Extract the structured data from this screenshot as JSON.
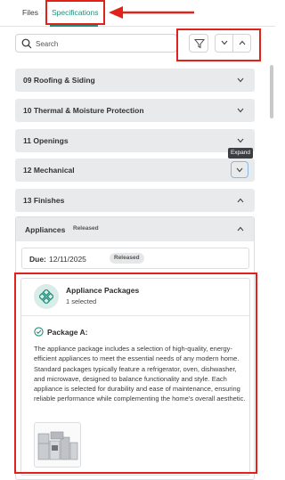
{
  "tabs": [
    {
      "label": "Files"
    },
    {
      "label": "Specifications",
      "active": true
    }
  ],
  "search": {
    "placeholder": "Search"
  },
  "toolbar": {
    "filter_icon": "filter-icon",
    "collapse_icon": "chevron-down-icon",
    "expand_icon": "chevron-up-icon"
  },
  "sections": [
    {
      "label": "09 Roofing & Siding",
      "state": "collapsed"
    },
    {
      "label": "10 Thermal & Moisture Protection",
      "state": "collapsed"
    },
    {
      "label": "11 Openings",
      "state": "collapsed"
    },
    {
      "label": "12 Mechanical",
      "state": "collapsed"
    },
    {
      "label": "13 Finishes",
      "state": "expanded"
    }
  ],
  "tooltip": "Expand",
  "group": {
    "title": "Appliances",
    "status": "Released",
    "due_label": "Due:",
    "due_date": "12/11/2025",
    "due_status": "Released",
    "package": {
      "title": "Appliance Packages",
      "selected": "1 selected",
      "option_label": "Package A:",
      "description": "The appliance package includes a selection of high-quality, energy-efficient appliances to meet the essential needs of any modern home. Standard packages typically feature a refrigerator, oven, dishwasher, and microwave, designed to balance functionality and style. Each appliance is selected for durability and ease of maintenance, ensuring reliable performance while complementing the home's overall aesthetic."
    }
  },
  "colors": {
    "accent": "#1f8f7a",
    "annotation": "#e0221b",
    "row_bg": "#e9eaec"
  }
}
